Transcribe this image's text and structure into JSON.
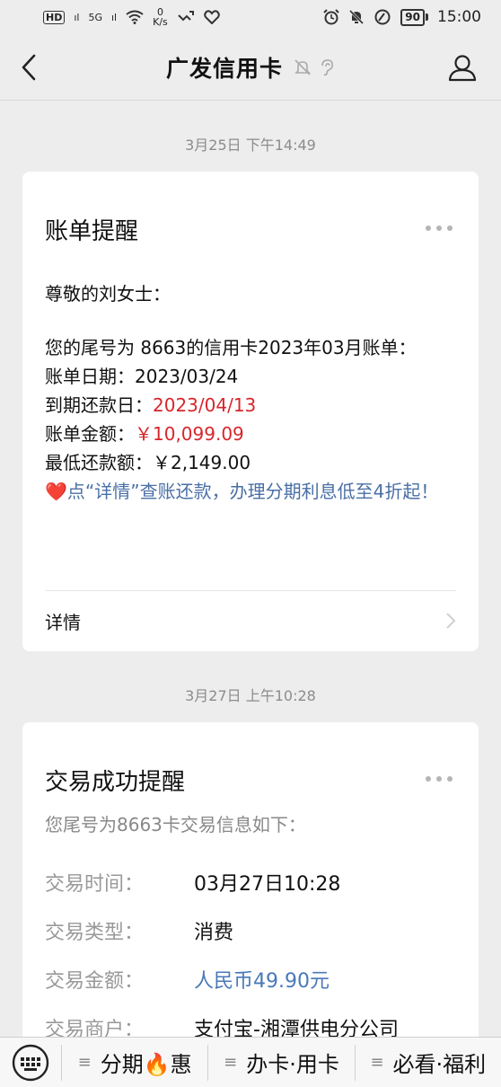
{
  "status_bar": {
    "hd_badge": "HD",
    "signal_1": "ıl",
    "network_5g": "5G",
    "signal_2": "ıl",
    "speed_value": "0",
    "speed_unit": "K/s",
    "battery": "90",
    "time": "15:00"
  },
  "header": {
    "title": "广发信用卡"
  },
  "messages": [
    {
      "timestamp": "3月25日 下午14:49",
      "title": "账单提醒",
      "greeting": "尊敬的刘女士：",
      "line_card": "您的尾号为 8663的信用卡2023年03月账单：",
      "bill_date_label": "账单日期：",
      "bill_date_value": "2023/03/24",
      "due_date_label": "到期还款日：",
      "due_date_value": "2023/04/13",
      "amount_label": "账单金额：",
      "amount_value": "￥10,099.09",
      "min_label": "最低还款额：",
      "min_value": "￥2,149.00",
      "heart": "❤️",
      "promo": "点“详情”查账还款，办理分期利息低至4折起！",
      "details_label": "详情"
    },
    {
      "timestamp": "3月27日 上午10:28",
      "title": "交易成功提醒",
      "intro": "您尾号为8663卡交易信息如下：",
      "rows": [
        {
          "label": "交易时间：",
          "value": "03月27日10:28"
        },
        {
          "label": "交易类型：",
          "value": "消费"
        },
        {
          "label": "交易金额：",
          "value": "人民币49.90元"
        },
        {
          "label": "交易商户：",
          "value": "支付宝-湘潭供电分公司"
        }
      ]
    }
  ],
  "bottom_menu": {
    "bars": "≡",
    "items": [
      {
        "label": "分期🔥惠"
      },
      {
        "label": "办卡·用卡"
      },
      {
        "label": "必看·福利"
      }
    ]
  },
  "colors": {
    "background": "#ededed",
    "card": "#ffffff",
    "red_highlight": "#d8262b",
    "link_blue": "#4a6fa5"
  },
  "icons": [
    "back-arrow-icon",
    "mute-bell-icon",
    "ear-icon",
    "profile-icon",
    "more-dots-icon",
    "chevron-right-icon",
    "keyboard-icon"
  ]
}
